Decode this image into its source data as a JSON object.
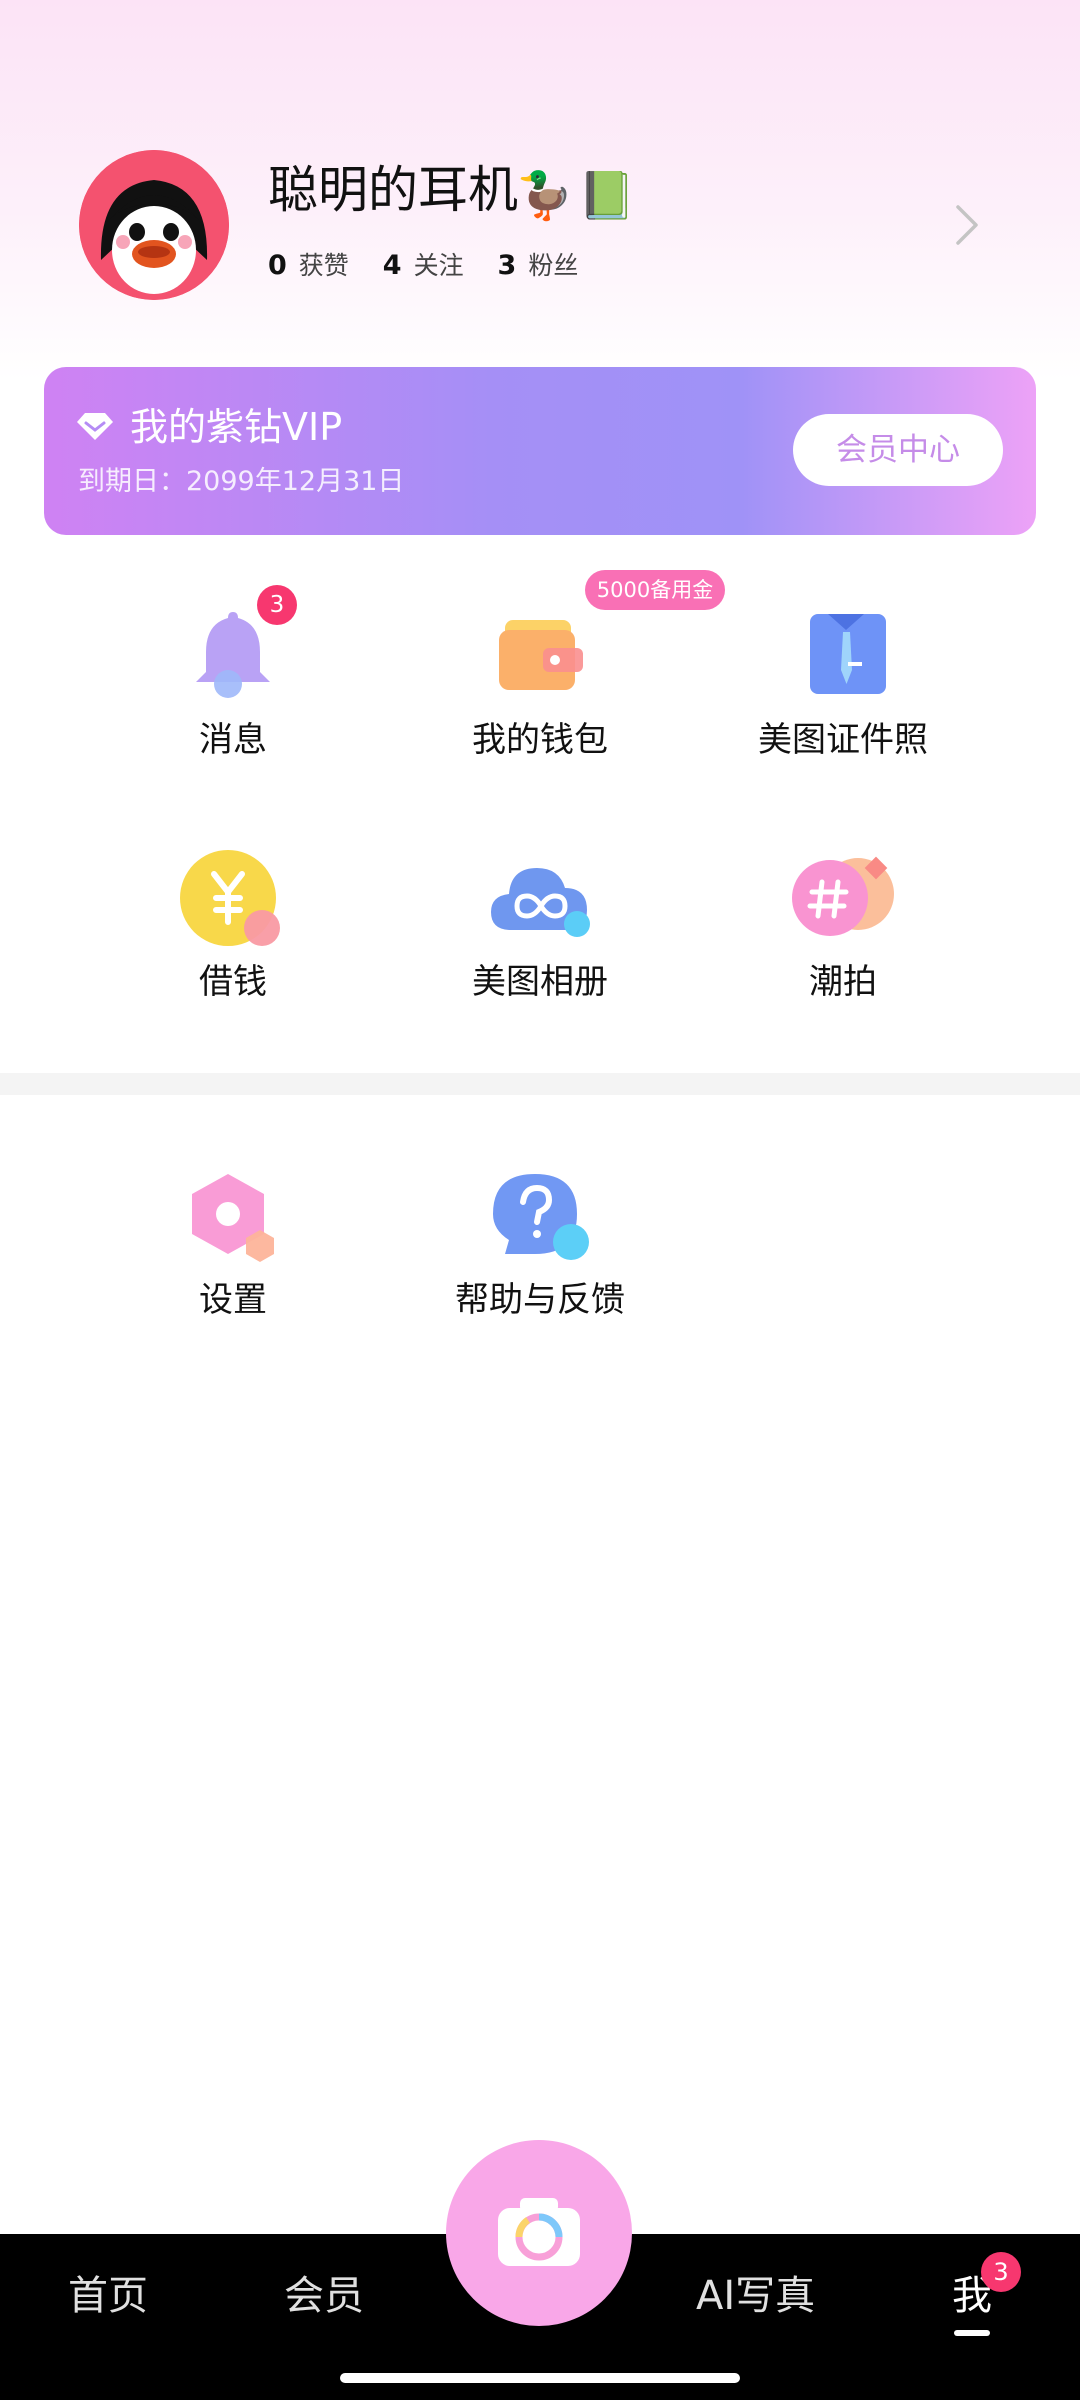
{
  "profile": {
    "username": "聪明的耳机",
    "name_emojis": [
      "🦆",
      "📗"
    ],
    "stats": [
      {
        "value": "0",
        "label": "获赞"
      },
      {
        "value": "4",
        "label": "关注"
      },
      {
        "value": "3",
        "label": "粉丝"
      }
    ]
  },
  "vip": {
    "title": "我的紫钻VIP",
    "expiry": "到期日：2099年12月31日",
    "button_label": "会员中心"
  },
  "grid": {
    "message": {
      "label": "消息",
      "badge": "3"
    },
    "wallet": {
      "label": "我的钱包",
      "badge": "5000备用金"
    },
    "id_photo": {
      "label": "美图证件照"
    },
    "borrow": {
      "label": "借钱"
    },
    "album": {
      "label": "美图相册"
    },
    "trend_shot": {
      "label": "潮拍"
    }
  },
  "more": {
    "settings": {
      "label": "设置"
    },
    "help": {
      "label": "帮助与反馈"
    }
  },
  "tabbar": {
    "home": "首页",
    "vip": "会员",
    "ai_photo": "AI写真",
    "me": "我",
    "me_badge": "3"
  },
  "colors": {
    "accent_pink": "#f970b5",
    "badge_red": "#f7376f",
    "vip_purple": "#a58ff6",
    "camera_pink": "#f9a7e8"
  }
}
